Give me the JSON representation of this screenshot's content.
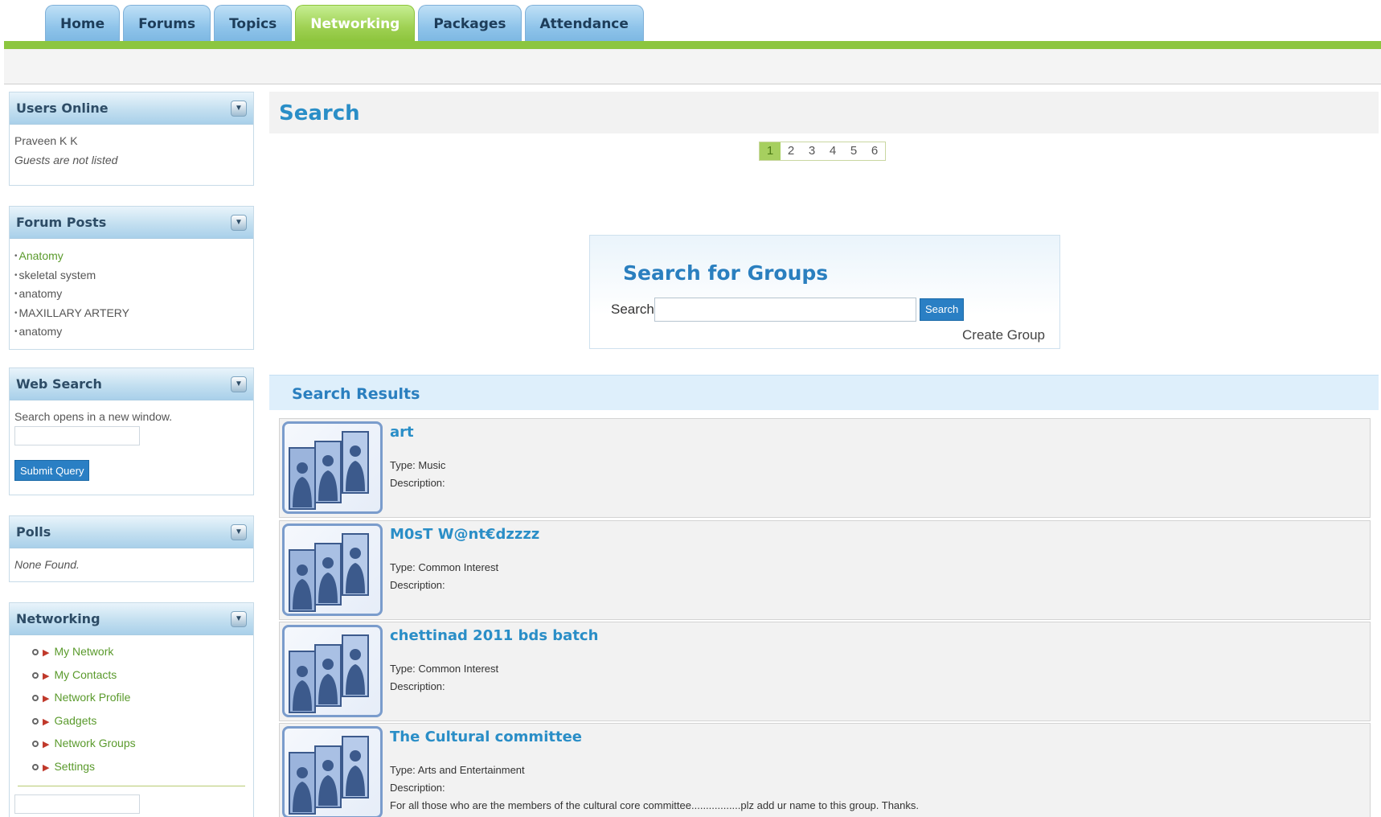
{
  "nav": {
    "tabs": [
      {
        "label": "Home"
      },
      {
        "label": "Forums"
      },
      {
        "label": "Topics"
      },
      {
        "label": "Networking"
      },
      {
        "label": "Packages"
      },
      {
        "label": "Attendance"
      }
    ],
    "active_tab": "Networking"
  },
  "sidebar": {
    "users_online": {
      "title": "Users Online",
      "user": "Praveen K K",
      "note": "Guests are not listed"
    },
    "forum_posts": {
      "title": "Forum Posts",
      "items": [
        "Anatomy",
        "skeletal system",
        "anatomy",
        "MAXILLARY ARTERY",
        "anatomy"
      ]
    },
    "web_search": {
      "title": "Web Search",
      "note": "Search opens in a new window.",
      "button": "Submit Query"
    },
    "polls": {
      "title": "Polls",
      "note": "None Found."
    },
    "networking": {
      "title": "Networking",
      "items": [
        "My Network",
        "My Contacts",
        "Network Profile",
        "Gadgets",
        "Network Groups",
        "Settings"
      ]
    }
  },
  "main": {
    "title": "Search",
    "pagination": {
      "pages": [
        "1",
        "2",
        "3",
        "4",
        "5",
        "6"
      ],
      "current": "1"
    },
    "search_groups": {
      "title": "Search for Groups",
      "label": "Search",
      "button": "Search",
      "create": "Create Group"
    },
    "results_title": "Search Results",
    "results": [
      {
        "name": "art",
        "type": "Type: Music",
        "description": "Description:",
        "description_text": ""
      },
      {
        "name": "M0sT W@nt€dzzzz",
        "type": "Type: Common Interest",
        "description": "Description:",
        "description_text": ""
      },
      {
        "name": "chettinad 2011 bds batch",
        "type": "Type: Common Interest",
        "description": "Description:",
        "description_text": ""
      },
      {
        "name": "The Cultural committee",
        "type": "Type: Arts and Entertainment",
        "description": "Description:",
        "description_text": "For all those who are the members of the cultural core committee.................plz add ur name to this group. Thanks."
      }
    ]
  },
  "colors": {
    "accent_blue": "#2a8ec7",
    "nav_green": "#8cc63f",
    "link_green": "#5a9a2c"
  }
}
